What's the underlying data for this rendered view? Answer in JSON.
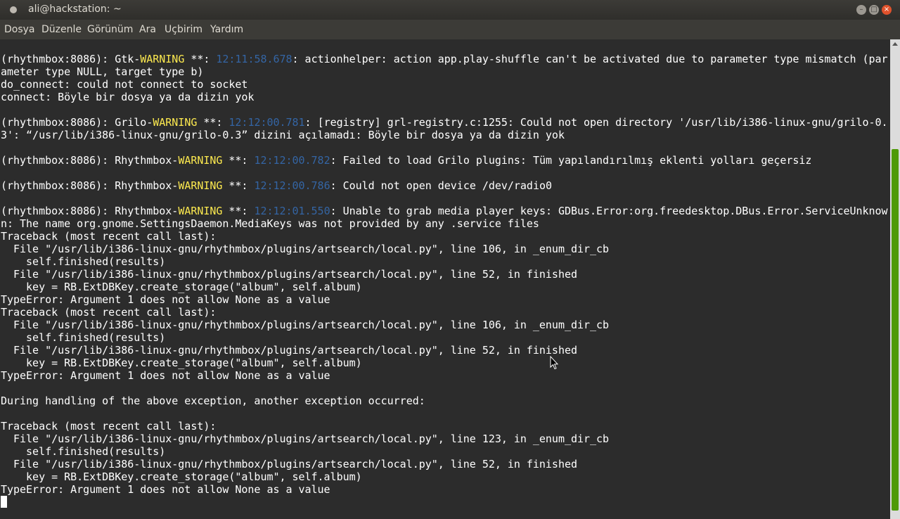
{
  "window": {
    "title": "ali@hackstation: ~"
  },
  "menubar": {
    "items": [
      "Dosya",
      "Düzenle",
      "Görünüm",
      "Ara",
      "Uçbirim",
      "Yardım"
    ]
  },
  "terminal": {
    "lines": [
      [
        {
          "t": "(rhythmbox:8086): Gtk-"
        },
        {
          "t": "WARNING",
          "c": "warn"
        },
        {
          "t": " **: "
        },
        {
          "t": "12:11:58.678",
          "c": "ts"
        },
        {
          "t": ": actionhelper: action app.play-shuffle can't be activated due to parameter type mismatch (par"
        }
      ],
      [
        {
          "t": "ameter type NULL, target type b)"
        }
      ],
      [
        {
          "t": "do_connect: could not connect to socket"
        }
      ],
      [
        {
          "t": "connect: Böyle bir dosya ya da dizin yok"
        }
      ],
      [
        {
          "t": ""
        }
      ],
      [
        {
          "t": "(rhythmbox:8086): Grilo-"
        },
        {
          "t": "WARNING",
          "c": "warn"
        },
        {
          "t": " **: "
        },
        {
          "t": "12:12:00.781",
          "c": "ts"
        },
        {
          "t": ": [registry] grl-registry.c:1255: Could not open directory '/usr/lib/i386-linux-gnu/grilo-0."
        }
      ],
      [
        {
          "t": "3': “/usr/lib/i386-linux-gnu/grilo-0.3” dizini açılamadı: Böyle bir dosya ya da dizin yok"
        }
      ],
      [
        {
          "t": ""
        }
      ],
      [
        {
          "t": "(rhythmbox:8086): Rhythmbox-"
        },
        {
          "t": "WARNING",
          "c": "warn"
        },
        {
          "t": " **: "
        },
        {
          "t": "12:12:00.782",
          "c": "ts"
        },
        {
          "t": ": Failed to load Grilo plugins: Tüm yapılandırılmış eklenti yolları geçersiz"
        }
      ],
      [
        {
          "t": ""
        }
      ],
      [
        {
          "t": "(rhythmbox:8086): Rhythmbox-"
        },
        {
          "t": "WARNING",
          "c": "warn"
        },
        {
          "t": " **: "
        },
        {
          "t": "12:12:00.786",
          "c": "ts"
        },
        {
          "t": ": Could not open device /dev/radio0"
        }
      ],
      [
        {
          "t": ""
        }
      ],
      [
        {
          "t": "(rhythmbox:8086): Rhythmbox-"
        },
        {
          "t": "WARNING",
          "c": "warn"
        },
        {
          "t": " **: "
        },
        {
          "t": "12:12:01.550",
          "c": "ts"
        },
        {
          "t": ": Unable to grab media player keys: GDBus.Error:org.freedesktop.DBus.Error.ServiceUnknow"
        }
      ],
      [
        {
          "t": "n: The name org.gnome.SettingsDaemon.MediaKeys was not provided by any .service files"
        }
      ],
      [
        {
          "t": "Traceback (most recent call last):"
        }
      ],
      [
        {
          "t": "  File \"/usr/lib/i386-linux-gnu/rhythmbox/plugins/artsearch/local.py\", line 106, in _enum_dir_cb"
        }
      ],
      [
        {
          "t": "    self.finished(results)"
        }
      ],
      [
        {
          "t": "  File \"/usr/lib/i386-linux-gnu/rhythmbox/plugins/artsearch/local.py\", line 52, in finished"
        }
      ],
      [
        {
          "t": "    key = RB.ExtDBKey.create_storage(\"album\", self.album)"
        }
      ],
      [
        {
          "t": "TypeError: Argument 1 does not allow None as a value"
        }
      ],
      [
        {
          "t": "Traceback (most recent call last):"
        }
      ],
      [
        {
          "t": "  File \"/usr/lib/i386-linux-gnu/rhythmbox/plugins/artsearch/local.py\", line 106, in _enum_dir_cb"
        }
      ],
      [
        {
          "t": "    self.finished(results)"
        }
      ],
      [
        {
          "t": "  File \"/usr/lib/i386-linux-gnu/rhythmbox/plugins/artsearch/local.py\", line 52, in finished"
        }
      ],
      [
        {
          "t": "    key = RB.ExtDBKey.create_storage(\"album\", self.album)"
        }
      ],
      [
        {
          "t": "TypeError: Argument 1 does not allow None as a value"
        }
      ],
      [
        {
          "t": ""
        }
      ],
      [
        {
          "t": "During handling of the above exception, another exception occurred:"
        }
      ],
      [
        {
          "t": ""
        }
      ],
      [
        {
          "t": "Traceback (most recent call last):"
        }
      ],
      [
        {
          "t": "  File \"/usr/lib/i386-linux-gnu/rhythmbox/plugins/artsearch/local.py\", line 123, in _enum_dir_cb"
        }
      ],
      [
        {
          "t": "    self.finished(results)"
        }
      ],
      [
        {
          "t": "  File \"/usr/lib/i386-linux-gnu/rhythmbox/plugins/artsearch/local.py\", line 52, in finished"
        }
      ],
      [
        {
          "t": "    key = RB.ExtDBKey.create_storage(\"album\", self.album)"
        }
      ],
      [
        {
          "t": "TypeError: Argument 1 does not allow None as a value"
        }
      ]
    ],
    "colors": {
      "background": "#2c2c2c",
      "text": "#ffffff",
      "warning": "#fce94f",
      "timestamp": "#3465a4"
    }
  },
  "icons": {
    "window_icon": "terminal-app-icon",
    "minimize": "minimize-icon",
    "maximize": "maximize-icon",
    "close": "close-icon"
  }
}
